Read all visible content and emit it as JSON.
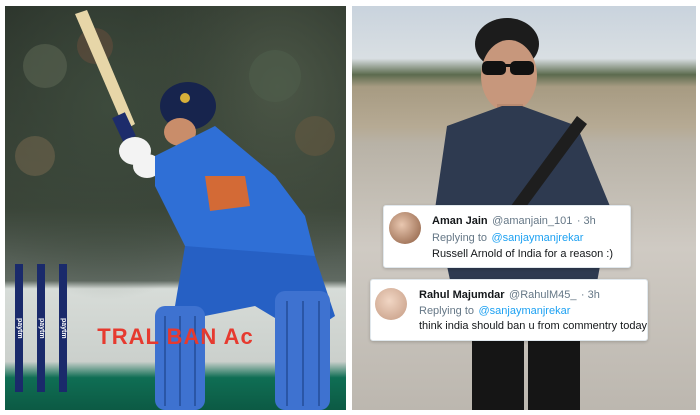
{
  "left_photo": {
    "banner": "TRAL BAN  Ac",
    "stump_brand": "paytm"
  },
  "tweets": [
    {
      "name": "Aman Jain",
      "handle": "@amanjain_101",
      "time": "· 3h",
      "replying_prefix": "Replying to",
      "replying_to": "@sanjaymanjrekar",
      "text": "Russell Arnold of India for a reason :)"
    },
    {
      "name": "Rahul Majumdar",
      "handle": "@RahulM45_",
      "time": "· 3h",
      "replying_prefix": "Replying to",
      "replying_to": "@sanjaymanjrekar",
      "text": "think india should ban u from commentry today"
    }
  ],
  "colors": {
    "jersey": "#2f6fd6",
    "tweet_link": "#1da1f2"
  }
}
